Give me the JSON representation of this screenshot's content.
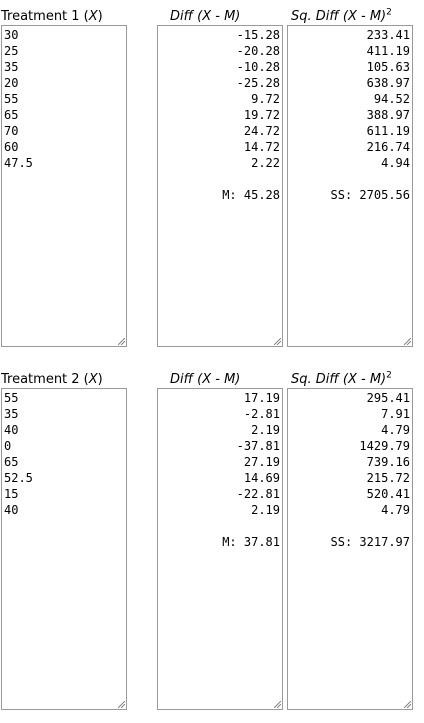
{
  "groups": [
    {
      "label_prefix": "Treatment 1 (",
      "label_var": "X",
      "label_suffix": ")",
      "diff_header": "Diff (X - M)",
      "sq_header": "Sq. Diff (X - M)",
      "sq_header_exp": "2",
      "values": [
        "30",
        "25",
        "35",
        "20",
        "55",
        "65",
        "70",
        "60",
        "47.5"
      ],
      "diffs": [
        "-15.28",
        "-20.28",
        "-10.28",
        "-25.28",
        "9.72",
        "19.72",
        "24.72",
        "14.72",
        "2.22"
      ],
      "sq_diffs": [
        "233.41",
        "411.19",
        "105.63",
        "638.97",
        "94.52",
        "388.97",
        "611.19",
        "216.74",
        "4.94"
      ],
      "mean_text": "M: 45.28",
      "ss_text": "SS: 2705.56"
    },
    {
      "label_prefix": "Treatment 2 (",
      "label_var": "X",
      "label_suffix": ")",
      "diff_header": "Diff (X - M)",
      "sq_header": "Sq. Diff (X - M)",
      "sq_header_exp": "2",
      "values": [
        "55",
        "35",
        "40",
        "0",
        "65",
        "52.5",
        "15",
        "40"
      ],
      "diffs": [
        "17.19",
        "-2.81",
        "2.19",
        "-37.81",
        "27.19",
        "14.69",
        "-22.81",
        "2.19"
      ],
      "sq_diffs": [
        "295.41",
        "7.91",
        "4.79",
        "1429.79",
        "739.16",
        "215.72",
        "520.41",
        "4.79"
      ],
      "mean_text": "M: 37.81",
      "ss_text": "SS: 3217.97"
    }
  ]
}
